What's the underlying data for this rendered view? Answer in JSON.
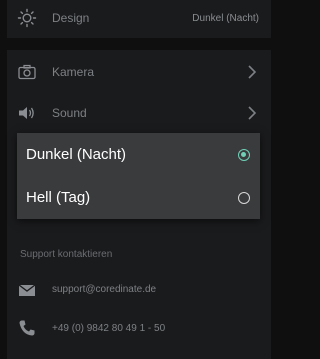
{
  "settings": {
    "design": {
      "label": "Design",
      "value": "Dunkel (Nacht)",
      "icon": "brightness-icon"
    },
    "camera": {
      "label": "Kamera",
      "icon": "camera-icon"
    },
    "sound": {
      "label": "Sound",
      "icon": "speaker-icon"
    }
  },
  "support": {
    "title": "Support kontaktieren",
    "email": "support@coredinate.de",
    "phone": "+49 (0) 9842 80 49 1 - 50"
  },
  "dialog": {
    "options": [
      {
        "label": "Dunkel (Nacht)",
        "selected": true
      },
      {
        "label": "Hell (Tag)",
        "selected": false
      }
    ]
  },
  "colors": {
    "accent": "#6fd0b5",
    "background": "#0f0f10",
    "card": "#1a1b1d",
    "dialog": "#3a3b3d"
  }
}
